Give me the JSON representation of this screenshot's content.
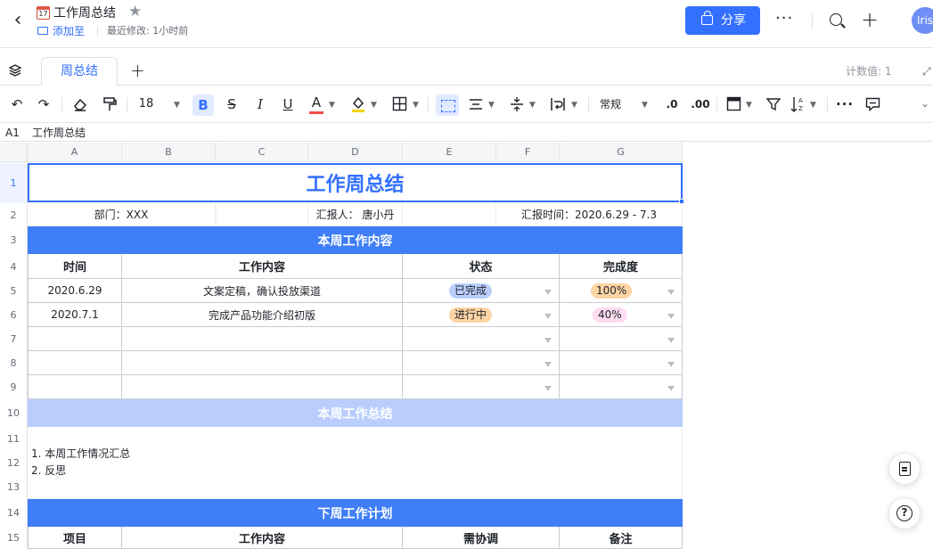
{
  "header": {
    "doc_icon_day": "17",
    "title": "工作周总结",
    "add_to_label": "添加至",
    "last_modified": "最近修改: 1小时前",
    "share_label": "分享",
    "more_glyph": "···",
    "avatar_text": "Iris"
  },
  "tabs": {
    "sheets": [
      "周总结"
    ],
    "add_glyph": "+",
    "count_label": "计数值: 1"
  },
  "toolbar": {
    "undo": "↶",
    "redo": "↷",
    "font_size": "18",
    "bold": "B",
    "strike": "S",
    "italic": "I",
    "underline": "U",
    "text_color_glyph": "A",
    "number_format": "常规",
    "more_glyph": "···"
  },
  "formula_bar": {
    "cell_ref": "A1",
    "content": "工作周总结"
  },
  "grid": {
    "columns": [
      "A",
      "B",
      "C",
      "D",
      "E",
      "F",
      "G"
    ],
    "rows": [
      "1",
      "2",
      "3",
      "4",
      "5",
      "6",
      "7",
      "8",
      "9",
      "10",
      "11",
      "12",
      "13",
      "14",
      "15"
    ],
    "title": "工作周总结",
    "info": {
      "department": "部门：XXX",
      "reporter": "汇报人：  唐小丹",
      "report_time": "汇报时间：2020.6.29 - 7.3"
    },
    "section_this_week": "本周工作内容",
    "table_headers": [
      "时间",
      "工作内容",
      "状态",
      "完成度"
    ],
    "table_rows": [
      {
        "time": "2020.6.29",
        "content": "文案定稿，确认投放渠道",
        "status": "已完成",
        "progress": "100%"
      },
      {
        "time": "2020.7.1",
        "content": "完成产品功能介绍初版",
        "status": "进行中",
        "progress": "40%"
      }
    ],
    "section_summary": "本周工作总结",
    "summary_lines": [
      "1. 本周工作情况汇总",
      "2. 反思"
    ],
    "section_next_week": "下周工作计划",
    "next_headers": [
      "项目",
      "工作内容",
      "需协调",
      "备注"
    ]
  },
  "colors": {
    "accent": "#3370ff",
    "banner": "#3f7ef7",
    "banner_light": "#bacefd",
    "tag_done": "#bacefd",
    "tag_progress": "#fed4a4",
    "tag_partial": "#fdddef"
  }
}
